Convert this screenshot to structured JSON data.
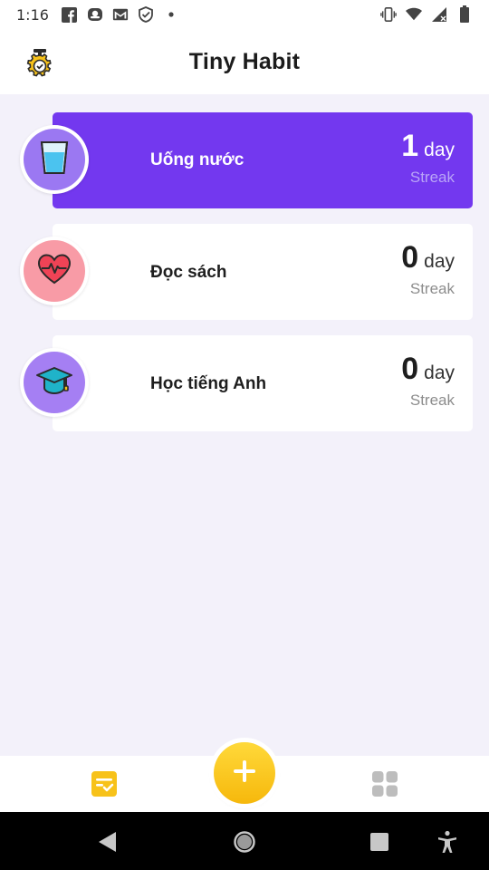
{
  "status_bar": {
    "time": "1:16",
    "left_icons": [
      "facebook-icon",
      "messenger-icon",
      "gmail-icon",
      "shield-check-icon",
      "dot-icon"
    ],
    "right_icons": [
      "vibrate-icon",
      "wifi-icon",
      "signal-icon",
      "battery-icon"
    ]
  },
  "header": {
    "title": "Tiny Habit",
    "logo_icon": "stopwatch-gear-icon"
  },
  "habits": [
    {
      "name": "Uống nước",
      "streak_value": "1",
      "streak_unit": "day",
      "streak_label": "Streak",
      "icon": "water-glass-icon",
      "active": true
    },
    {
      "name": "Đọc sách",
      "streak_value": "0",
      "streak_unit": "day",
      "streak_label": "Streak",
      "icon": "heart-pulse-icon",
      "active": false
    },
    {
      "name": "Học tiếng Anh",
      "streak_value": "0",
      "streak_unit": "day",
      "streak_label": "Streak",
      "icon": "graduation-cap-icon",
      "active": false
    }
  ],
  "bottom_nav": {
    "left_icon": "habit-list-icon",
    "fab_icon": "plus-icon",
    "right_icon": "grid-apps-icon"
  },
  "system_nav": [
    "back-icon",
    "home-icon",
    "recents-icon",
    "accessibility-icon"
  ],
  "colors": {
    "accent_purple": "#7338ef",
    "fab_yellow": "#f6b80c",
    "background": "#f3f1fa"
  }
}
